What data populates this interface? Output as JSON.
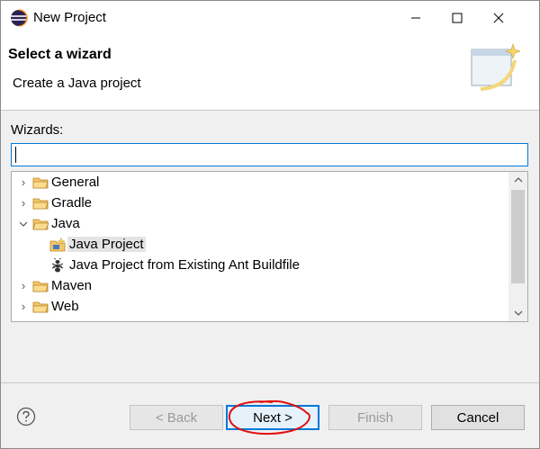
{
  "window": {
    "title": "New Project"
  },
  "banner": {
    "title": "Select a wizard",
    "description": "Create a Java project"
  },
  "wizards": {
    "label": "Wizards:",
    "filter_value": "",
    "tree": [
      {
        "label": "General",
        "expanded": false,
        "level": 0,
        "icon": "folder-icon"
      },
      {
        "label": "Gradle",
        "expanded": false,
        "level": 0,
        "icon": "folder-icon"
      },
      {
        "label": "Java",
        "expanded": true,
        "level": 0,
        "icon": "folder-icon"
      },
      {
        "label": "Java Project",
        "level": 1,
        "icon": "java-project-icon",
        "selected": true
      },
      {
        "label": "Java Project from Existing Ant Buildfile",
        "level": 1,
        "icon": "ant-icon"
      },
      {
        "label": "Maven",
        "expanded": false,
        "level": 0,
        "icon": "folder-icon"
      },
      {
        "label": "Web",
        "expanded": false,
        "level": 0,
        "icon": "folder-icon"
      }
    ]
  },
  "buttons": {
    "back": "< Back",
    "next": "Next >",
    "finish": "Finish",
    "cancel": "Cancel"
  },
  "colors": {
    "accent": "#0078d7",
    "annotation": "#e01010",
    "folder": "#e8b24a"
  }
}
